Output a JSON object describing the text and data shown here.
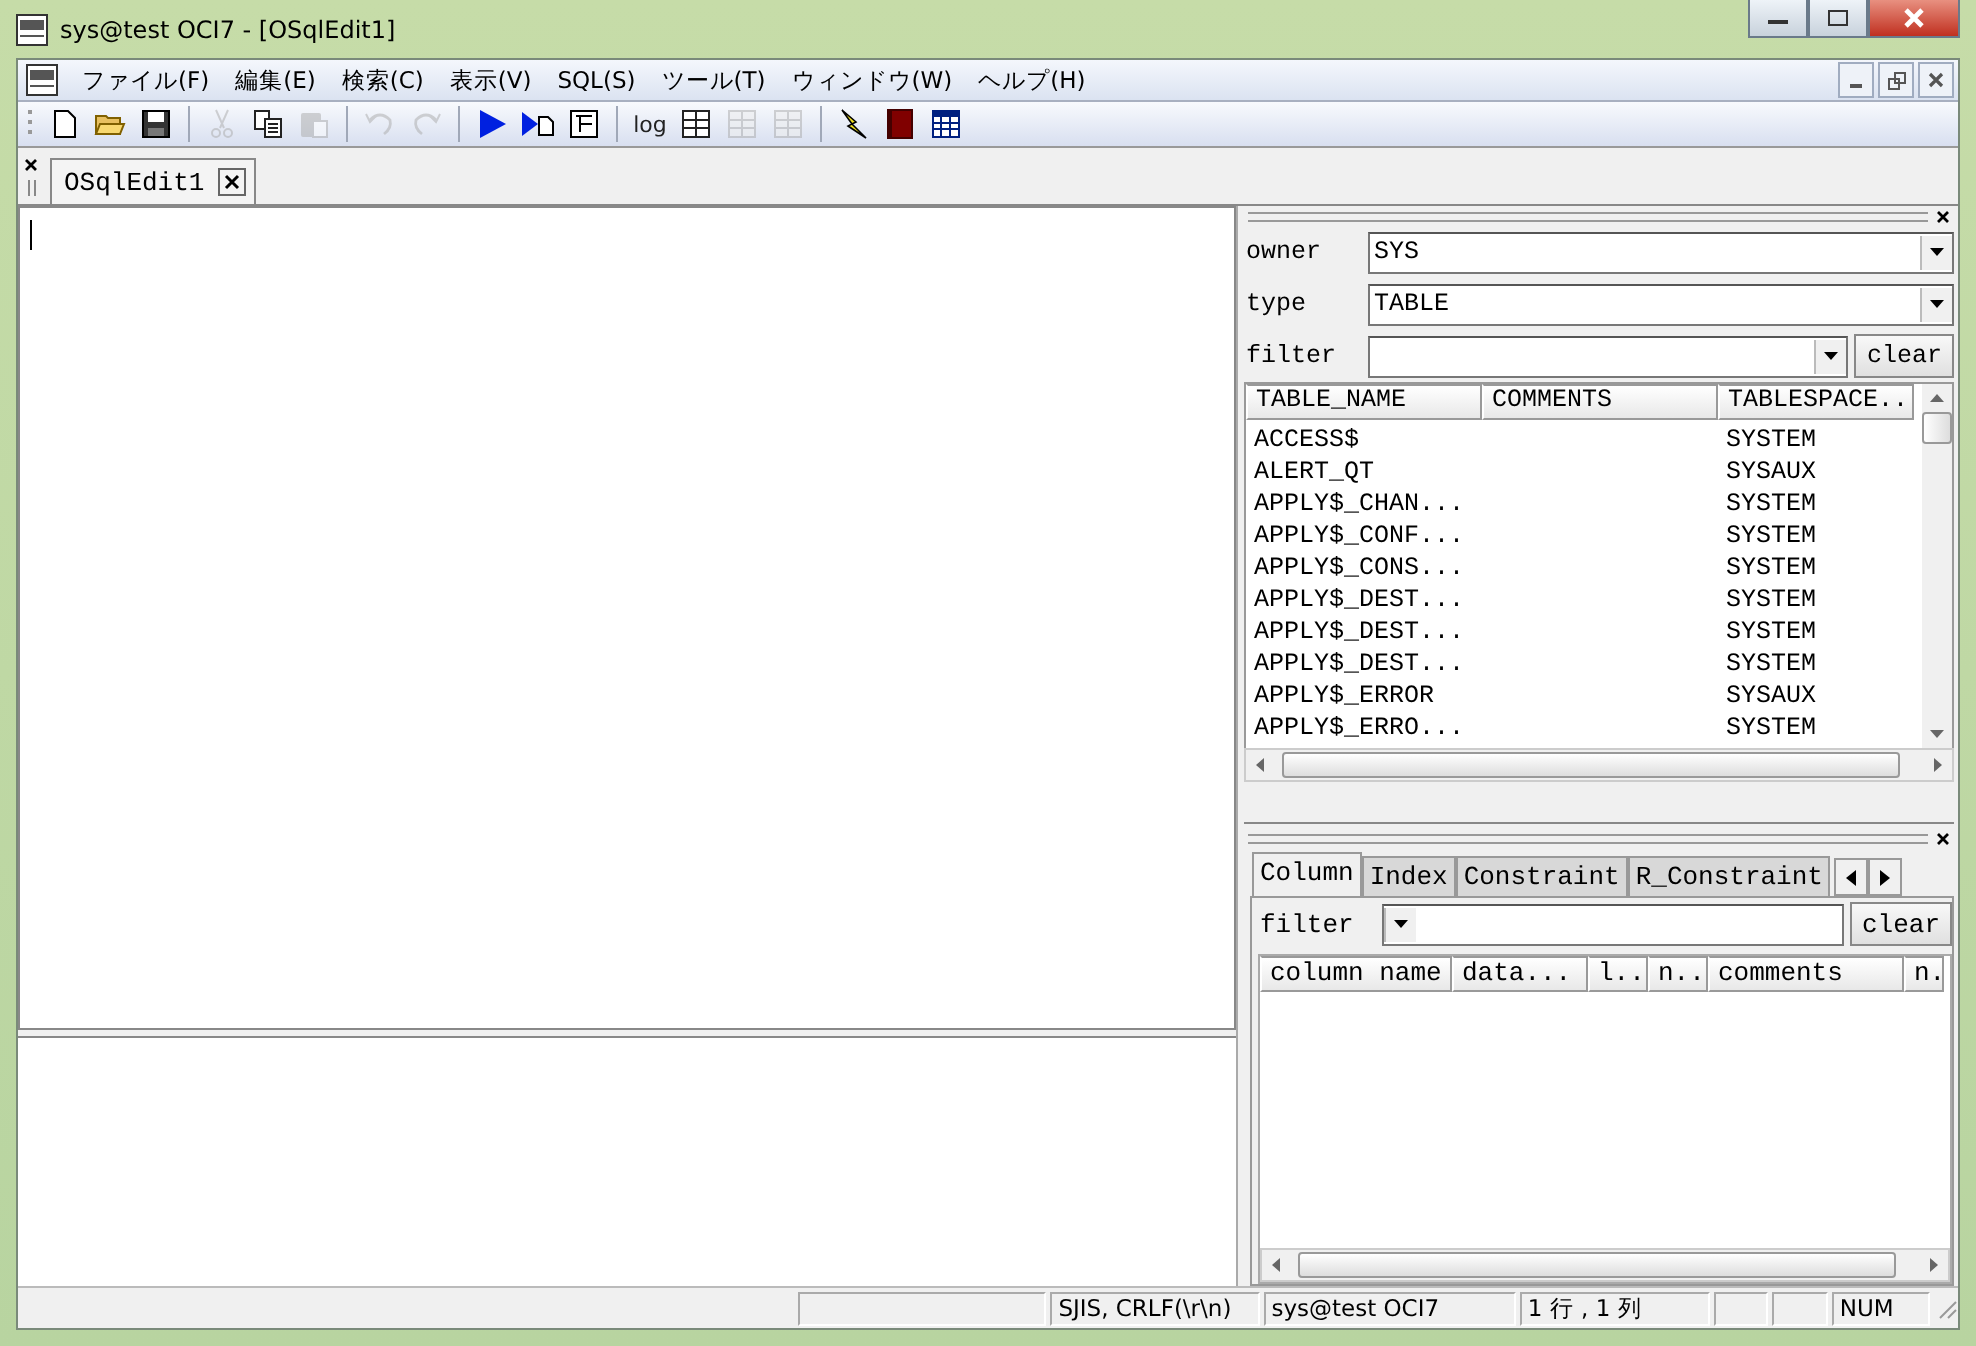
{
  "window": {
    "title": "sys@test OCI7 - [OSqlEdit1]"
  },
  "menu": [
    "ファイル(F)",
    "編集(E)",
    "検索(C)",
    "表示(V)",
    "SQL(S)",
    "ツール(T)",
    "ウィンドウ(W)",
    "ヘルプ(H)"
  ],
  "toolbar": [
    {
      "kind": "new",
      "disabled": false
    },
    {
      "kind": "open",
      "disabled": false
    },
    {
      "kind": "save",
      "disabled": false
    },
    {
      "kind": "sep"
    },
    {
      "kind": "cut",
      "disabled": true
    },
    {
      "kind": "copy",
      "disabled": false
    },
    {
      "kind": "paste",
      "disabled": true
    },
    {
      "kind": "sep"
    },
    {
      "kind": "undo",
      "disabled": true
    },
    {
      "kind": "redo",
      "disabled": true
    },
    {
      "kind": "sep"
    },
    {
      "kind": "run",
      "disabled": false
    },
    {
      "kind": "runfile",
      "disabled": false
    },
    {
      "kind": "frame",
      "disabled": false
    },
    {
      "kind": "sep"
    },
    {
      "kind": "text",
      "label": "log",
      "disabled": false
    },
    {
      "kind": "grid",
      "disabled": false
    },
    {
      "kind": "grid2",
      "disabled": true
    },
    {
      "kind": "grid3",
      "disabled": true
    },
    {
      "kind": "sep"
    },
    {
      "kind": "bolt",
      "disabled": false
    },
    {
      "kind": "book",
      "disabled": false
    },
    {
      "kind": "table",
      "disabled": false
    }
  ],
  "doc_tabs": [
    {
      "label": "OSqlEdit1",
      "selected": true
    }
  ],
  "object_panel": {
    "owner_label": "owner",
    "owner": "SYS",
    "type_label": "type",
    "type": "TABLE",
    "filter_label": "filter",
    "clear": "clear",
    "columns": [
      "TABLE_NAME",
      "COMMENTS",
      "TABLESPACE.."
    ],
    "rows": [
      [
        "ACCESS$",
        "",
        "SYSTEM"
      ],
      [
        "ALERT_QT",
        "",
        "SYSAUX"
      ],
      [
        "APPLY$_CHAN...",
        "",
        "SYSTEM"
      ],
      [
        "APPLY$_CONF...",
        "",
        "SYSTEM"
      ],
      [
        "APPLY$_CONS...",
        "",
        "SYSTEM"
      ],
      [
        "APPLY$_DEST...",
        "",
        "SYSTEM"
      ],
      [
        "APPLY$_DEST...",
        "",
        "SYSTEM"
      ],
      [
        "APPLY$_DEST...",
        "",
        "SYSTEM"
      ],
      [
        "APPLY$_ERROR",
        "",
        "SYSAUX"
      ],
      [
        "APPLY$_ERRO...",
        "",
        "SYSTEM"
      ]
    ]
  },
  "detail_panel": {
    "tabs": [
      {
        "label": "Column",
        "selected": true
      },
      {
        "label": "Index",
        "selected": false
      },
      {
        "label": "Constraint",
        "selected": false
      },
      {
        "label": "R_Constraint",
        "selected": false
      }
    ],
    "filter_label": "filter",
    "clear": "clear",
    "columns": [
      "column name",
      "data...",
      "l..",
      "n..",
      "comments",
      "n."
    ]
  },
  "status_bar": [
    "SJIS, CRLF(\\r\\n)",
    "sys@test OCI7",
    "1 行 , 1 列",
    "NUM"
  ]
}
